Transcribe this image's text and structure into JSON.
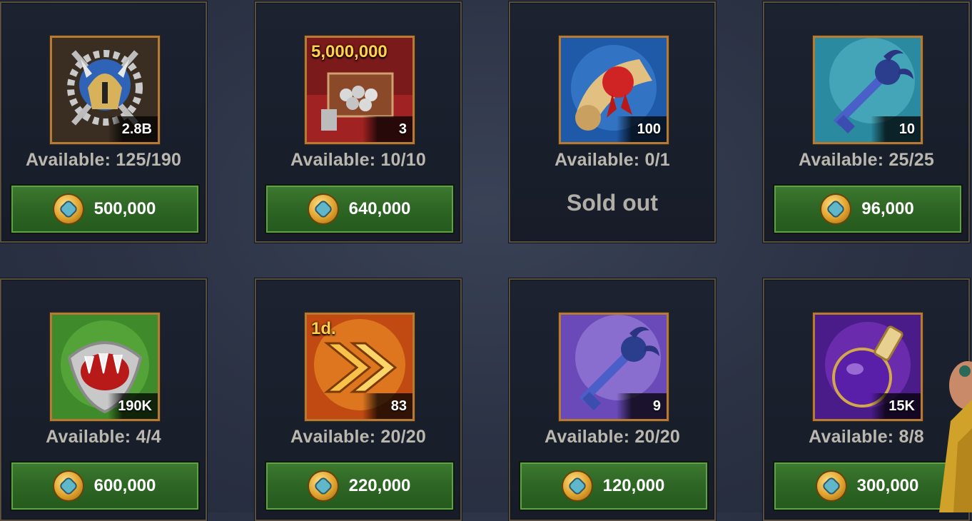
{
  "items": [
    {
      "qty": "2.8B",
      "available": "Available: 125/190",
      "price": "500,000",
      "icon": "veteran-helmet-icon"
    },
    {
      "qty": "3",
      "available": "Available: 10/10",
      "price": "640,000",
      "icon": "silver-chest-icon",
      "overlay": "5,000,000"
    },
    {
      "qty": "100",
      "available": "Available: 0/1",
      "sold_out": "Sold out",
      "icon": "sealed-scroll-icon"
    },
    {
      "qty": "10",
      "available": "Available: 25/25",
      "price": "96,000",
      "icon": "blue-key-icon"
    },
    {
      "qty": "190K",
      "available": "Available: 4/4",
      "price": "600,000",
      "icon": "claw-shield-icon"
    },
    {
      "qty": "83",
      "available": "Available: 20/20",
      "price": "220,000",
      "icon": "speedup-arrows-icon",
      "overlay": "1d."
    },
    {
      "qty": "9",
      "available": "Available: 20/20",
      "price": "120,000",
      "icon": "purple-key-icon"
    },
    {
      "qty": "15K",
      "available": "Available: 8/8",
      "price": "300,000",
      "icon": "potion-flask-icon"
    }
  ],
  "colors": {
    "button_green": "#2d6524",
    "frame_gold": "#b47a36",
    "card_bg": "#1c2230"
  }
}
